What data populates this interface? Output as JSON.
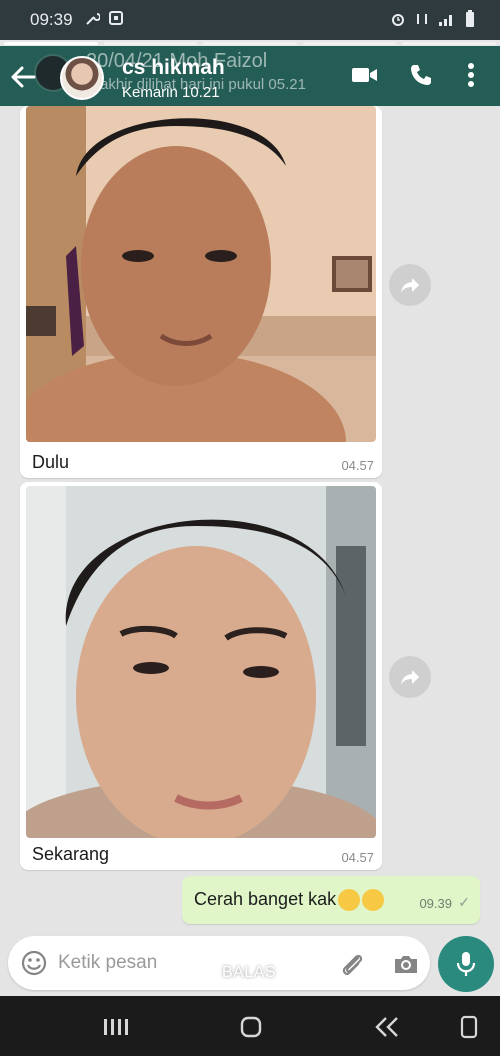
{
  "status_bar": {
    "time": "09:39"
  },
  "header": {
    "behind_title": "20/04/21 Moh Faizol",
    "behind_subtitle": "akhir dilihat hari ini pukul 05.21",
    "title": "cs hikmah",
    "subtitle": "Kemarin 10.21"
  },
  "messages": [
    {
      "type": "image",
      "caption": "Dulu",
      "time": "04.57"
    },
    {
      "type": "image",
      "caption": "Sekarang",
      "time": "04.57"
    },
    {
      "type": "text",
      "direction": "outgoing",
      "text": "Cerah banget kak",
      "time": "09.39",
      "status": "✓"
    }
  ],
  "input": {
    "placeholder": "Ketik pesan"
  },
  "reply_label": "BALAS",
  "colors": {
    "header": "#245d56",
    "outgoing_bubble": "#e0f5c8",
    "accent": "#2a8a7e"
  },
  "icons": [
    "back-arrow-icon",
    "video-call-icon",
    "voice-call-icon",
    "more-icon",
    "forward-icon",
    "emoji-icon",
    "attach-icon",
    "camera-icon",
    "mic-icon",
    "chevron-up-icon"
  ]
}
